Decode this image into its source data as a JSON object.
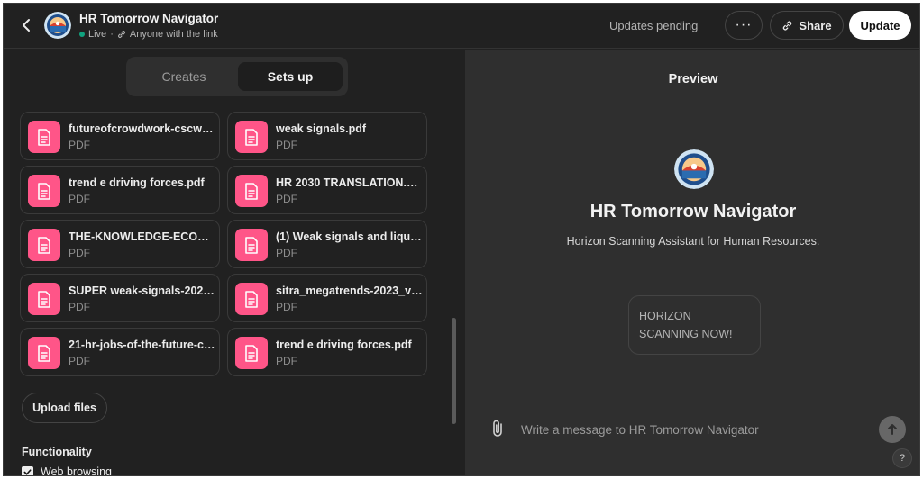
{
  "header": {
    "title": "HR Tomorrow Navigator",
    "status": "Live",
    "visibility": "Anyone with the link",
    "pending_text": "Updates pending",
    "more_label": "···",
    "share_label": "Share",
    "update_label": "Update"
  },
  "tabs": [
    {
      "label": "Creates",
      "active": false
    },
    {
      "label": "Sets up",
      "active": true
    }
  ],
  "files": [
    {
      "name": "futureofcrowdwork-cscw2…",
      "type": "PDF"
    },
    {
      "name": "weak signals.pdf",
      "type": "PDF"
    },
    {
      "name": "trend e driving forces.pdf",
      "type": "PDF"
    },
    {
      "name": "HR 2030 TRANSLATION.p…",
      "type": "PDF"
    },
    {
      "name": "THE-KNOWLEDGE-ECON…",
      "type": "PDF"
    },
    {
      "name": "(1) Weak signals and liquid …",
      "type": "PDF"
    },
    {
      "name": "SUPER weak-signals-2022…",
      "type": "PDF"
    },
    {
      "name": "sitra_megatrends-2023_v…",
      "type": "PDF"
    },
    {
      "name": "21-hr-jobs-of-the-future-c…",
      "type": "PDF"
    },
    {
      "name": "trend e driving forces.pdf",
      "type": "PDF"
    }
  ],
  "upload_label": "Upload files",
  "functionality": {
    "heading": "Functionality",
    "web_browsing_label": "Web browsing",
    "web_browsing_checked": true
  },
  "preview": {
    "title": "Preview",
    "gpt_name": "HR Tomorrow Navigator",
    "description": "Horizon Scanning Assistant for Human Resources.",
    "starter_line1": "HORIZON",
    "starter_line2": "SCANNING NOW!",
    "input_placeholder": "Write a message to HR Tomorrow Navigator",
    "help_label": "?"
  },
  "colors": {
    "background": "#212121",
    "preview_bg": "#2f2f2f",
    "file_icon": "#ff5588",
    "live_dot": "#10a37f"
  },
  "icons": {
    "back": "chevron-left-icon",
    "link": "link-icon",
    "share": "share-link-icon",
    "file": "document-icon",
    "attach": "paperclip-icon",
    "send": "arrow-up-icon"
  }
}
